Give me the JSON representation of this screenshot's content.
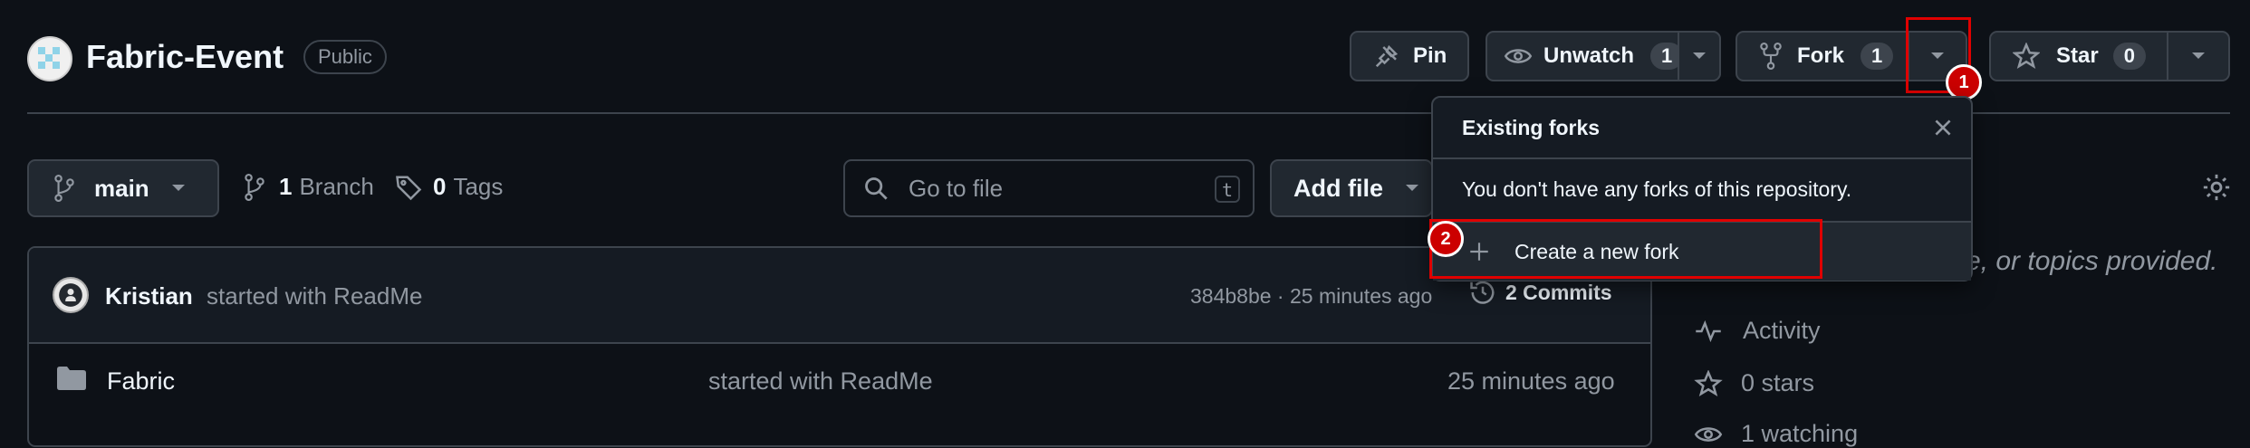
{
  "repo": {
    "name": "Fabric-Event",
    "visibility": "Public"
  },
  "actions": {
    "pin": "Pin",
    "unwatch": "Unwatch",
    "unwatch_count": "1",
    "fork": "Fork",
    "fork_count": "1",
    "star": "Star",
    "star_count": "0"
  },
  "toolbar": {
    "branch": "main",
    "branches_count": "1",
    "branches_label": "Branch",
    "tags_count": "0",
    "tags_label": "Tags",
    "search_placeholder": "Go to file",
    "search_shortcut": "t",
    "add_file": "Add file"
  },
  "commit": {
    "author": "Kristian",
    "message": "started with ReadMe",
    "hash_time": "384b8be · 25 minutes ago",
    "commits_label": "2 Commits"
  },
  "files": [
    {
      "name": "Fabric",
      "message": "started with ReadMe",
      "time": "25 minutes ago"
    }
  ],
  "fork_popup": {
    "title": "Existing forks",
    "empty_text": "You don't have any forks of this repository.",
    "create_label": "Create a new fork"
  },
  "sidebar": {
    "about_tail": "e, or topics provided.",
    "activity": "Activity",
    "stars": "0 stars",
    "watching": "1 watching"
  },
  "annotations": {
    "badge1": "1",
    "badge2": "2",
    "color": "#e00000"
  }
}
